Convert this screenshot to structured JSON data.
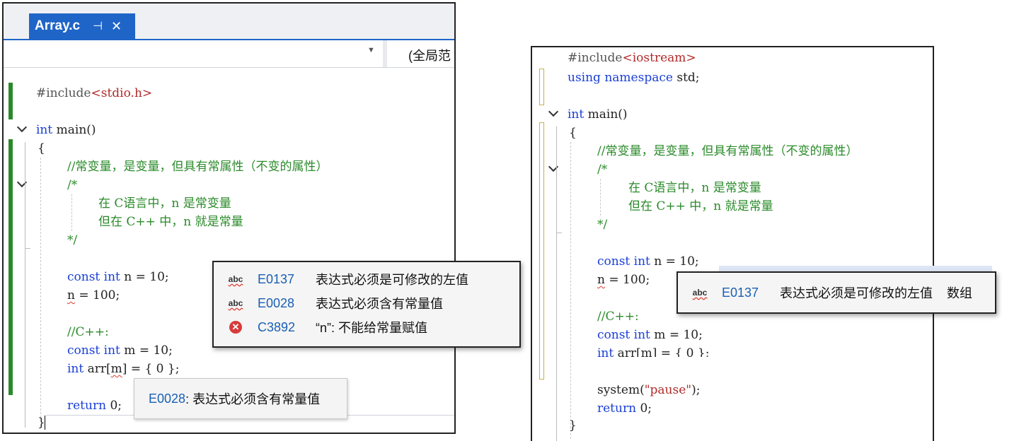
{
  "left": {
    "tab": {
      "title": "Array.c",
      "pin": "⊣",
      "close": "✕"
    },
    "nav": {
      "scope": "(全局范"
    },
    "code": {
      "include_kw": "#include",
      "include_arg": "<stdio.h>",
      "main_type": "int",
      "main_name": " main()",
      "open_brace": "{",
      "comment1": "//常变量，是变量，但具有常属性（不变的属性）",
      "block_open": "/*",
      "block_l1": "在 C语言中，n 是常变量",
      "block_l2": "但在 C++ 中，n 就是常量",
      "block_close": "*/",
      "const_kw": "const int",
      "const_rest": " n = 10;",
      "assign_n": "n",
      "assign_rest": " = 100;",
      "cpp_comment": "//C++:",
      "const_m_kw": "const int",
      "const_m_rest": " m = 10;",
      "arr_kw": "int",
      "arr_a": " arr[",
      "arr_m": "m",
      "arr_b": "] = { 0 };",
      "return_kw": "return",
      "return_rest": " 0;",
      "close_brace": "}"
    },
    "error_popup": [
      {
        "icon": "abc",
        "code": "E0137",
        "msg": "表达式必须是可修改的左值"
      },
      {
        "icon": "abc",
        "code": "E0028",
        "msg": "表达式必须含有常量值"
      },
      {
        "icon": "error",
        "code": "C3892",
        "msg": "“n”: 不能给常量赋值"
      }
    ],
    "tooltip": {
      "code": "E0028",
      "msg": ": 表达式必须含有常量值"
    }
  },
  "right": {
    "code": {
      "include_kw": "#include",
      "include_arg": "<iostream>",
      "using": "using namespace",
      "using_rest": " std;",
      "main_type": "int",
      "main_name": " main()",
      "open_brace": "{",
      "comment1": "//常变量，是变量，但具有常属性（不变的属性）",
      "block_open": "/*",
      "block_l1": "在 C语言中，n 是常变量",
      "block_l2": "但在 C++ 中，n 就是常量",
      "block_close": "*/",
      "const_kw": "const int",
      "const_rest": " n = 10;",
      "assign_n": "n",
      "assign_rest": " = 100;",
      "cpp_comment": "//C++:",
      "const_m_kw": "const int",
      "const_m_rest": " m = 10;",
      "arr_kw": "int",
      "arr_rest": " arr[m] = { 0 };",
      "system_a": "system(",
      "system_str": "\"pause\"",
      "system_b": ");",
      "return_kw": "return",
      "return_rest": " 0;",
      "close_brace": "}"
    },
    "error_popup": {
      "icon": "abc",
      "code": "E0137",
      "msg": "表达式必须是可修改的左值",
      "extra": "数组"
    }
  },
  "colors": {
    "tab_bg": "#1f65c8",
    "keyword": "#1a3fd6",
    "comment": "#2a8a2a",
    "string": "#b02a2a",
    "change_bar": "#2a8a2a",
    "saved_bar": "#c8b04a"
  }
}
